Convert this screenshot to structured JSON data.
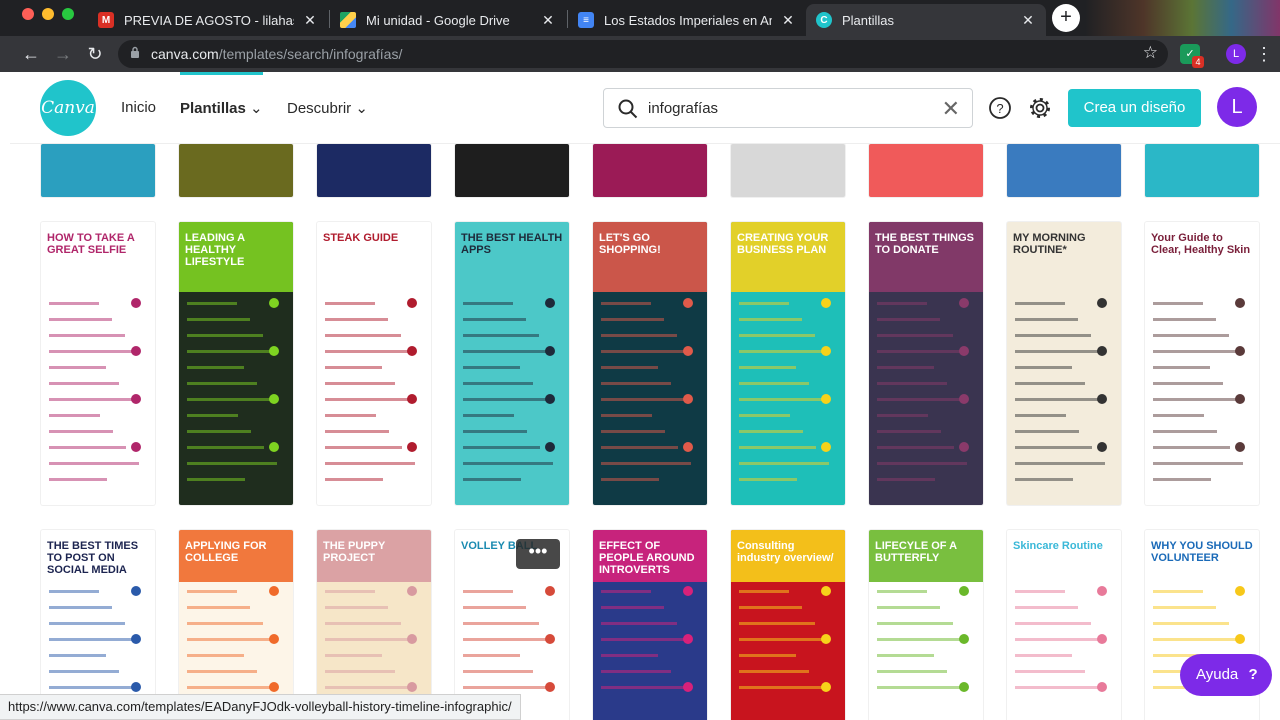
{
  "browser": {
    "tabs": [
      {
        "title": "PREVIA DE AGOSTO - lilahass",
        "favicon": "gmail-icon",
        "fav_color": "#d93025"
      },
      {
        "title": "Mi unidad - Google Drive",
        "favicon": "drive-icon",
        "fav_color": "#1fa463"
      },
      {
        "title": "Los Estados Imperiales en Amé",
        "favicon": "docs-icon",
        "fav_color": "#4285f4"
      },
      {
        "title": "Plantillas",
        "favicon": "canva-icon",
        "fav_color": "#20c4cb"
      }
    ],
    "url_host": "canva.com",
    "url_path": "/templates/search/infografías/",
    "profile_initial": "L",
    "ext_badge": "4"
  },
  "header": {
    "nav": [
      "Inicio",
      "Plantillas",
      "Descubrir"
    ],
    "search_value": "infografías",
    "create_label": "Crea un diseño",
    "avatar_initial": "L",
    "logo_text": "Canva"
  },
  "templates": {
    "row1": [
      {
        "title": "",
        "bg": "#2b9fbf"
      },
      {
        "title": "",
        "bg": "#6a6a1f"
      },
      {
        "title": "",
        "bg": "#1c2a63"
      },
      {
        "title": "",
        "bg": "#1e1e1e"
      },
      {
        "title": "",
        "bg": "#9b1b56"
      },
      {
        "title": "",
        "bg": "#d8d8d8"
      },
      {
        "title": "",
        "bg": "#f05a5a"
      },
      {
        "title": "",
        "bg": "#3a7bbf"
      },
      {
        "title": "",
        "bg": "#2bb7c7"
      }
    ],
    "row2": [
      {
        "title": "HOW TO TAKE A GREAT SELFIE",
        "bg": "#ffffff",
        "fg": "#b0266a",
        "accent": "#b0266a"
      },
      {
        "title": "LEADING A HEALTHY LIFESTYLE",
        "bg": "#1f2d1e",
        "fg": "#ffffff",
        "accent": "#7ed321"
      },
      {
        "title": "STEAK GUIDE",
        "bg": "#ffffff",
        "fg": "#b01c2e",
        "accent": "#b01c2e"
      },
      {
        "title": "THE BEST HEALTH APPS",
        "bg": "#4cc8c8",
        "fg": "#1e2a3a",
        "accent": "#1e2a3a"
      },
      {
        "title": "LET'S GO SHOPPING!",
        "bg": "#0f3a45",
        "fg": "#ffffff",
        "accent": "#e05a4a"
      },
      {
        "title": "CREATING YOUR BUSINESS PLAN",
        "bg": "#1ebfb8",
        "fg": "#ffffff",
        "accent": "#f7d21a"
      },
      {
        "title": "THE BEST THINGS TO DONATE",
        "bg": "#3a3450",
        "fg": "#ffffff",
        "accent": "#8a3a6a"
      },
      {
        "title": "MY MORNING ROUTINE*",
        "bg": "#f3ecdc",
        "fg": "#333333",
        "accent": "#333333"
      },
      {
        "title": "Your Guide to Clear, Healthy Skin",
        "bg": "#ffffff",
        "fg": "#7a1f3a",
        "accent": "#5a3a3a"
      }
    ],
    "row3": [
      {
        "title": "THE BEST TIMES TO POST ON SOCIAL MEDIA",
        "bg": "#ffffff",
        "fg": "#1c2450",
        "accent": "#2a5aaa"
      },
      {
        "title": "APPLYING FOR COLLEGE",
        "bg": "#fdf5e8",
        "fg": "#ffffff",
        "accent": "#f06a2a"
      },
      {
        "title": "THE PUPPY PROJECT",
        "bg": "#f6e6c8",
        "fg": "#ffffff",
        "accent": "#d89aa0"
      },
      {
        "title": "VOLLEY BALL",
        "bg": "#ffffff",
        "fg": "#1a8ab0",
        "accent": "#d64a3a"
      },
      {
        "title": "EFFECT OF PEOPLE AROUND INTROVERTS",
        "bg": "#2a3a8a",
        "fg": "#ffffff",
        "accent": "#d8217a"
      },
      {
        "title": "Consulting industry overview/",
        "bg": "#c8141e",
        "fg": "#ffffff",
        "accent": "#f7d21a"
      },
      {
        "title": "LIFECYLE OF A BUTTERFLY",
        "bg": "#ffffff",
        "fg": "#ffffff",
        "accent": "#6ab82a"
      },
      {
        "title": "Skincare Routine",
        "bg": "#ffffff",
        "fg": "#3ab8d8",
        "accent": "#e87a9a"
      },
      {
        "title": "WHY YOU SHOULD VOLUNTEER",
        "bg": "#ffffff",
        "fg": "#1a6ab8",
        "accent": "#f7c81a"
      }
    ]
  },
  "status_url": "https://www.canva.com/templates/EADanyFJOdk-volleyball-history-timeline-infographic/",
  "help_label": "Ayuda",
  "more_label": "•••"
}
